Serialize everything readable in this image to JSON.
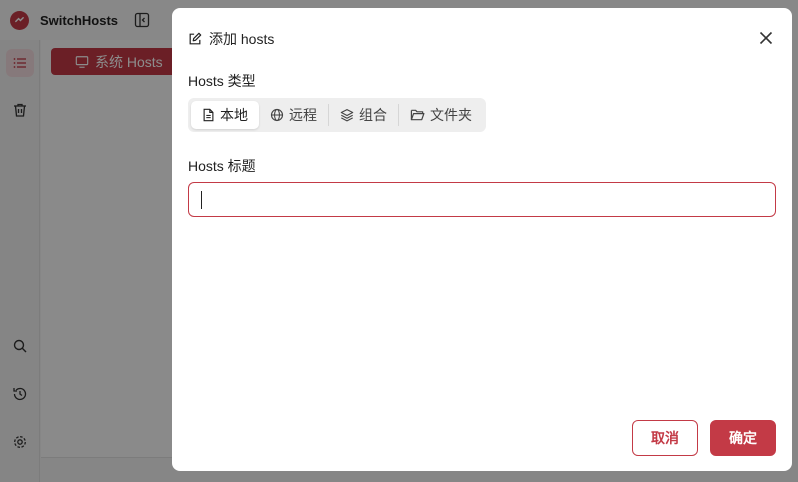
{
  "app": {
    "title": "SwitchHosts",
    "system_hosts_label": "系统 Hosts"
  },
  "modal": {
    "title": "添加 hosts",
    "type_label": "Hosts 类型",
    "types": [
      {
        "label": "本地",
        "icon": "file-icon",
        "selected": true
      },
      {
        "label": "远程",
        "icon": "globe-icon",
        "selected": false
      },
      {
        "label": "组合",
        "icon": "layers-icon",
        "selected": false
      },
      {
        "label": "文件夹",
        "icon": "folder-icon",
        "selected": false
      }
    ],
    "title_label": "Hosts 标题",
    "title_value": "",
    "cancel_label": "取消",
    "ok_label": "确定"
  },
  "colors": {
    "accent": "#c33a46",
    "mask": "rgba(0,0,0,0.45)"
  }
}
